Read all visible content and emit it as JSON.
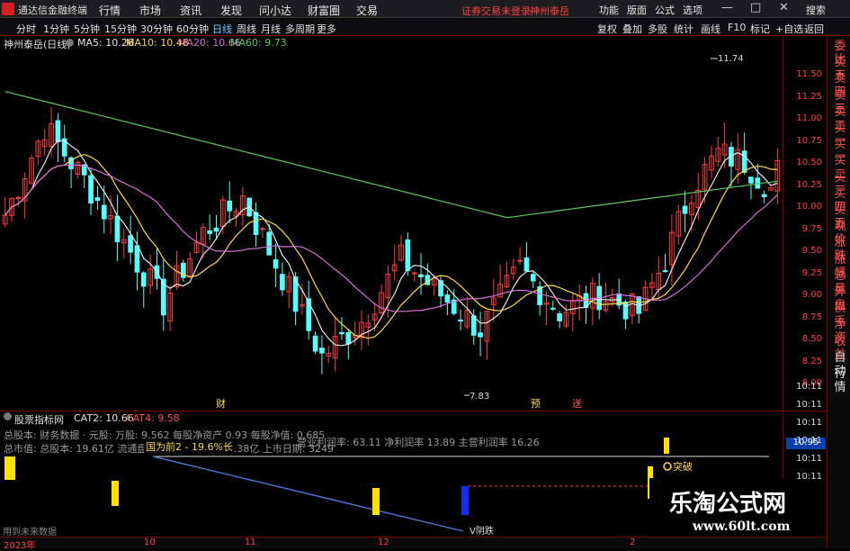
{
  "app": {
    "title": "通达信金融终端"
  },
  "menu": [
    "行情",
    "市场",
    "资讯",
    "发现",
    "问小达",
    "财富圈",
    "交易"
  ],
  "alerts": {
    "login": "证券交易未登录",
    "stock": "神州泰岳"
  },
  "top_right": [
    "功能",
    "版面",
    "公式",
    "选项"
  ],
  "window_buttons": {
    "search": "搜索",
    "min": "—",
    "max": "□",
    "close": "✕"
  },
  "timeframes": [
    "分时",
    "1分钟",
    "5分钟",
    "15分钟",
    "30分钟",
    "60分钟",
    "日线",
    "周线",
    "月线",
    "多周期",
    "更多"
  ],
  "active_timeframe": "日线",
  "toolbar_right": [
    "复权",
    "叠加",
    "多股",
    "统计",
    "画线",
    "F10",
    "标记",
    "+自选",
    "返回"
  ],
  "main_info": {
    "stock": "神州泰岳(日线)",
    "ma5": "MA5: 10.26",
    "ma10": "MA10: 10.48",
    "ma20": "MA20: 10.66",
    "ma60": "MA60: 9.73"
  },
  "price_axis": [
    "11.50",
    "11.25",
    "11.00",
    "10.75",
    "10.50",
    "10.25",
    "10.00",
    "9.75",
    "9.50",
    "9.25",
    "9.00",
    "8.75",
    "8.50",
    "8.25",
    "8.00"
  ],
  "annotations": {
    "high": "11.74",
    "low": "7.83",
    "cai": "财",
    "yu": "预",
    "song": "送",
    "tupo": "突破",
    "vyin": "V阴跌",
    "gp": "国为前2 - 19.6%长",
    "yongdao": "用到未来数据"
  },
  "indicator": {
    "name": "股票指标网",
    "cat2": "CAT2: 10.66",
    "cat4": "CAT4: 9.58",
    "line1": "总股本: 财务数据 · 元股: 万股: 9.562 每股净资产 0.93 每股净值: 0.685",
    "line2": "营业利润率: 63.11 净利润率 13.89 主营利润率 16.26",
    "line3": "总市值: 总股本: 19.61亿 流通盘: 18.8亿 市值: 191.38亿 上市日期: 3249",
    "value_box": "10.95"
  },
  "right_panel": [
    "委比",
    "卖五",
    "卖四",
    "卖三",
    "卖二",
    "卖一",
    "买一",
    "买二",
    "买三",
    "买四",
    "买五",
    "现价",
    "涨跌",
    "涨幅",
    "总量",
    "外盘",
    "换手",
    "净资",
    "收益",
    "自动",
    "行情"
  ],
  "time_axis": [
    "10:11",
    "10:11",
    "10:11",
    "10:11",
    "10:11",
    "10:11"
  ],
  "dates": [
    "2023年",
    "10",
    "11",
    "12",
    "2"
  ],
  "watermark": {
    "title": "乐淘公式网",
    "url": "www.60lt.com"
  },
  "colors": {
    "up": "#ff3b3b",
    "down": "#54ffff",
    "ma5": "#e8e8e8",
    "ma10": "#ffd84d",
    "ma20": "#d86fd8",
    "ma60": "#5ec85e",
    "axis": "#ff4040"
  }
}
